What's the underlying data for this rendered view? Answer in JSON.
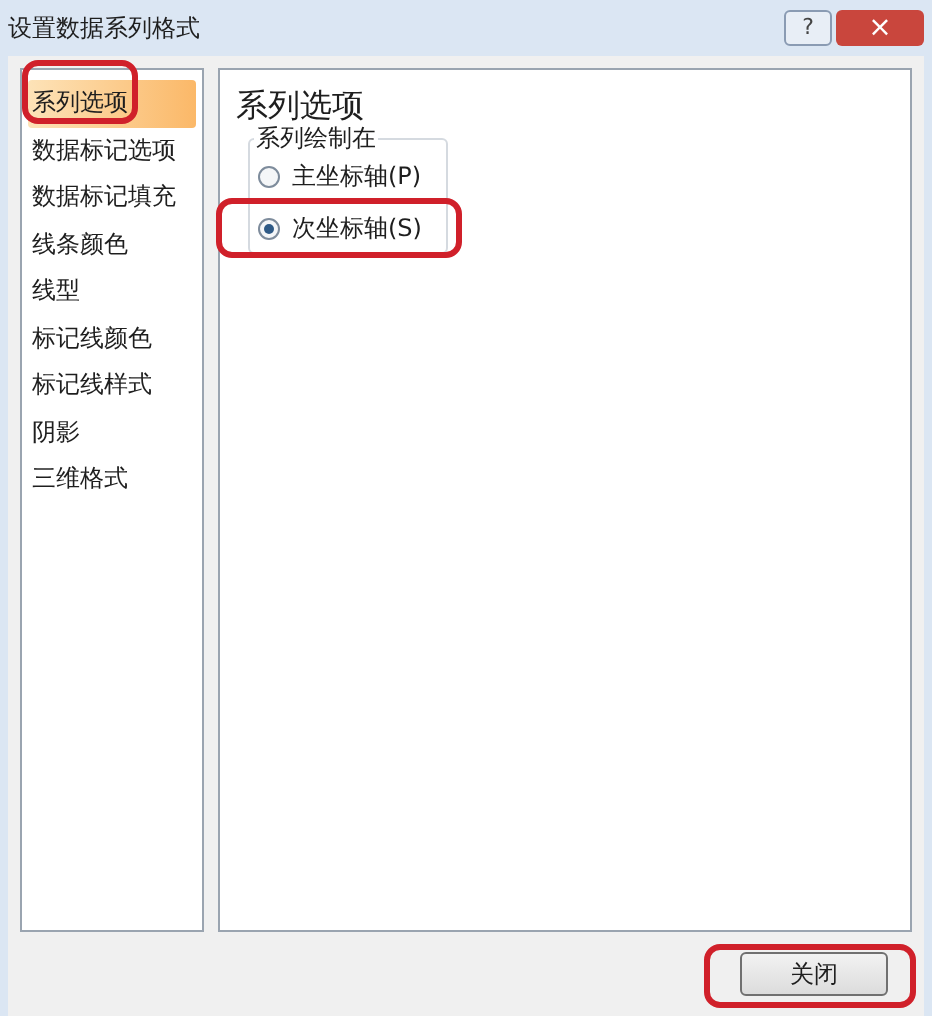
{
  "window": {
    "title": "设置数据系列格式",
    "help_button": "?",
    "close_button": "×"
  },
  "sidebar": {
    "items": [
      {
        "label": "系列选项",
        "selected": true
      },
      {
        "label": "数据标记选项",
        "selected": false
      },
      {
        "label": "数据标记填充",
        "selected": false
      },
      {
        "label": "线条颜色",
        "selected": false
      },
      {
        "label": "线型",
        "selected": false
      },
      {
        "label": "标记线颜色",
        "selected": false
      },
      {
        "label": "标记线样式",
        "selected": false
      },
      {
        "label": "阴影",
        "selected": false
      },
      {
        "label": "三维格式",
        "selected": false
      }
    ]
  },
  "panel": {
    "heading": "系列选项",
    "group": {
      "label": "系列绘制在",
      "options": [
        {
          "label": "主坐标轴(P)",
          "selected": false
        },
        {
          "label": "次坐标轴(S)",
          "selected": true
        }
      ]
    }
  },
  "footer": {
    "button": "关闭"
  }
}
